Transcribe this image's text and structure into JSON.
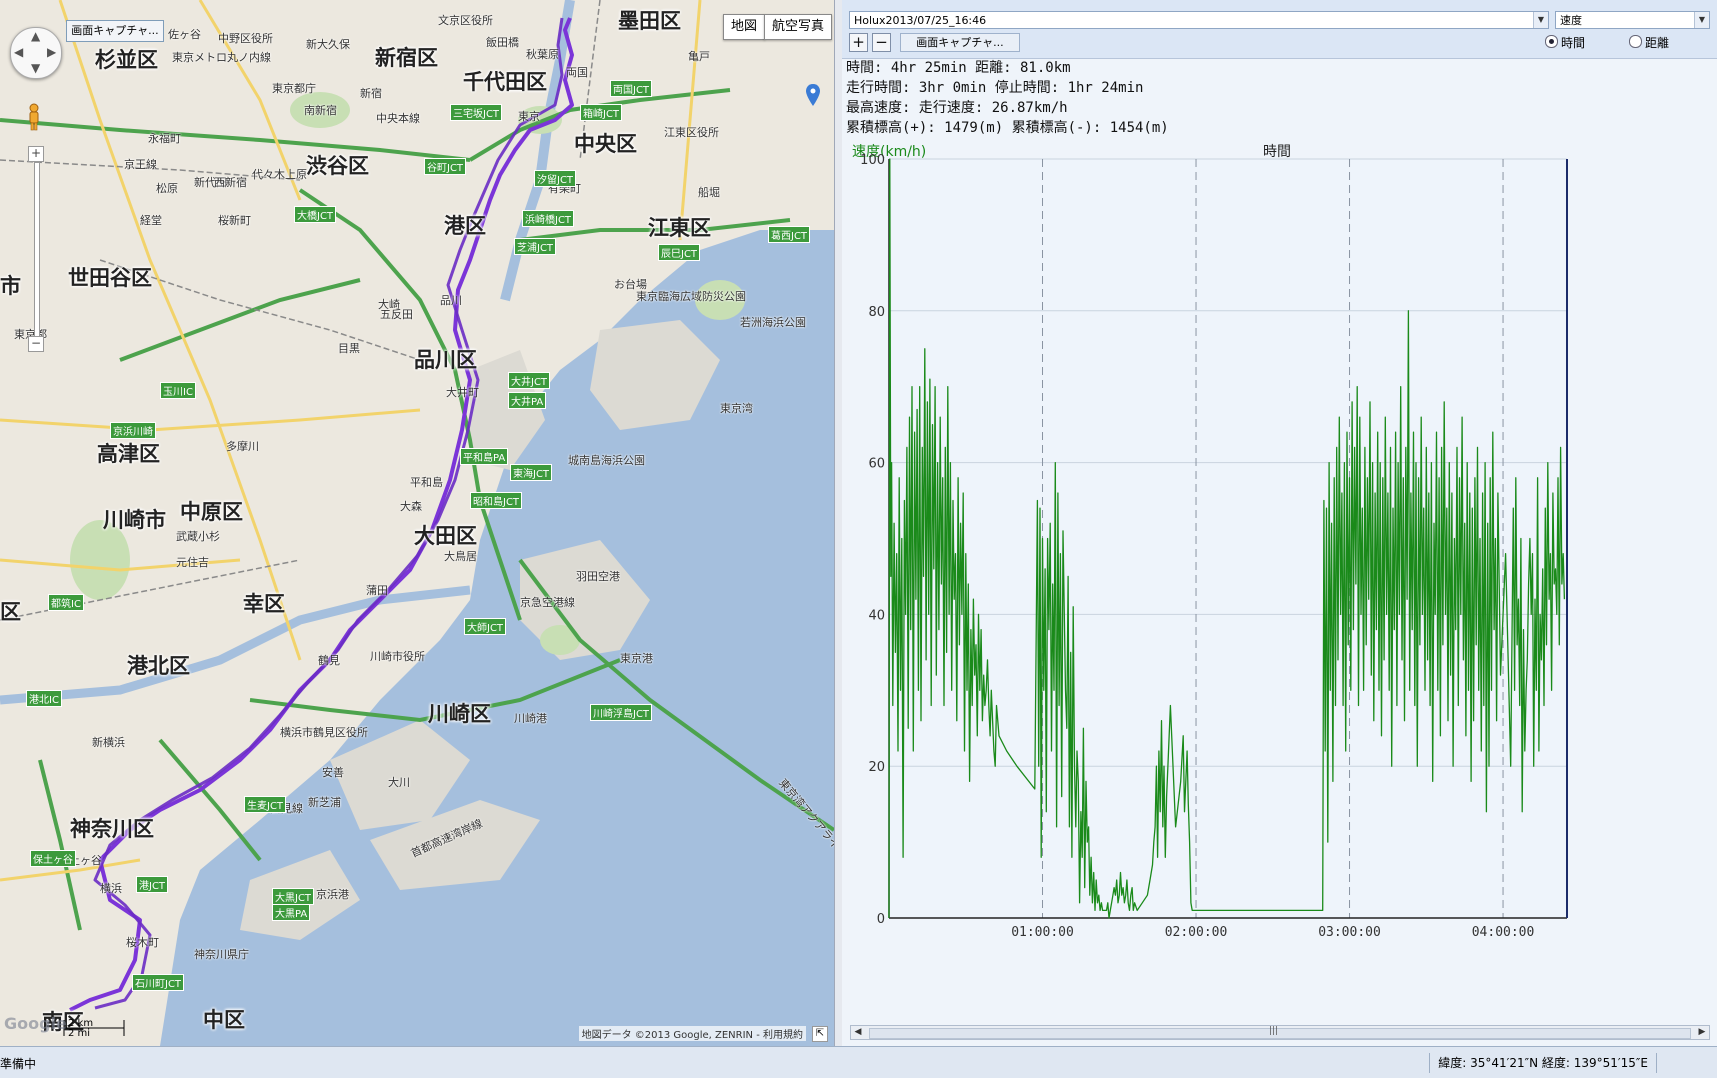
{
  "map": {
    "type_buttons": [
      "地図",
      "航空写真"
    ],
    "capture_button": "画面キャプチャ...",
    "wards": [
      "杉並区",
      "新宿区",
      "千代田区",
      "墨田区",
      "中央区",
      "渋谷区",
      "港区",
      "江東区",
      "世田谷区",
      "品川区",
      "高津区",
      "中原区",
      "川崎市",
      "大田区",
      "幸区",
      "港北区",
      "川崎区",
      "神奈川区",
      "中区",
      "南区",
      "市",
      "区"
    ],
    "small_labels": [
      "佐ヶ谷",
      "中野区役所",
      "文京区役所",
      "東京メトロ丸ノ内線",
      "新大久保",
      "飯田橋",
      "東京都庁",
      "新宿",
      "秋葉原",
      "両国",
      "亀戸",
      "南新宿",
      "中央本線",
      "東京",
      "江東区役所",
      "永福町",
      "京王線",
      "新代田",
      "代々木上原",
      "松原",
      "西新宿",
      "船堀",
      "経堂",
      "有楽町",
      "東京湾",
      "桜新町",
      "お台場",
      "大井町",
      "品川",
      "大崎",
      "五反田",
      "目黒",
      "武蔵小杉",
      "元住吉",
      "多摩川",
      "鶴見",
      "新横浜",
      "横浜",
      "桜木町",
      "京浜港",
      "川崎港",
      "羽田空港",
      "東京港",
      "平和島",
      "大森",
      "蒲田",
      "大鳥居",
      "京急空港線",
      "川崎市役所",
      "横浜市鶴見区役所",
      "首都高速湾岸線",
      "新芝浦",
      "安善",
      "大川",
      "鶴見線",
      "保土ヶ谷",
      "神奈川県庁",
      "東京都",
      "東京臨海広域防災公園",
      "若洲海浜公園",
      "城南島海浜公園",
      "東京湾アクアライン"
    ],
    "jct_labels": [
      "三宅坂JCT",
      "谷町JCT",
      "汐留JCT",
      "浜崎橋JCT",
      "芝浦JCT",
      "大橋JCT",
      "大井JCT",
      "大井PA",
      "平和島PA",
      "東海JCT",
      "昭和島JCT",
      "大師JCT",
      "生麦JCT",
      "大黒JCT",
      "大黒PA",
      "川崎浮島JCT",
      "辰巳JCT",
      "葛西JCT",
      "箱崎JCT",
      "両国JCT",
      "京浜川崎",
      "玉川IC",
      "都筑IC",
      "港北IC",
      "保土ヶ谷",
      "石川町JCT",
      "港JCT"
    ],
    "scale_km": "2 km",
    "scale_mi": "2 mi",
    "attribution": "地図データ ©2013 Google, ZENRIN - 利用規約",
    "google_logo": "Google",
    "route_color": "#7b35d8"
  },
  "toolbar": {
    "file": "Holux2013/07/25_16:46",
    "metric": "速度",
    "add": "+",
    "remove": "−",
    "capture_button": "画面キャプチャ...",
    "radio_time": "時間",
    "radio_distance": "距離",
    "selected_radio": "時間"
  },
  "stats": {
    "line1": "時間: 4hr 25min 距離: 81.0km",
    "line2": "走行時間: 3hr 0min 停止時間: 1hr 24min",
    "line3": "最高速度:          走行速度: 26.87km/h",
    "line4": "累積標高(+): 1479(m) 累積標高(-): 1454(m)"
  },
  "chart_data": {
    "type": "line",
    "title": "時間",
    "ylabel": "速度(km/h)",
    "xlabel": "",
    "ylim": [
      0,
      100
    ],
    "xlim_minutes": [
      0,
      265
    ],
    "y_ticks": [
      0,
      20,
      40,
      60,
      80,
      100
    ],
    "x_ticks": [
      "01:00:00",
      "02:00:00",
      "03:00:00",
      "04:00:00"
    ],
    "x_tick_minutes": [
      60,
      120,
      180,
      240
    ],
    "grid": true,
    "line_color": "#1a8a1a",
    "series": [
      {
        "x_minutes": [
          0,
          0.3,
          0.7,
          1,
          1.5,
          2,
          2.5,
          3,
          3.5,
          4,
          4.5,
          5,
          5.5,
          6,
          6.5,
          7,
          7.5,
          8,
          8.5,
          9,
          9.5,
          10,
          10.5,
          11,
          11.5,
          12,
          12.5,
          13,
          13.5,
          14,
          14.5,
          15,
          15.5,
          16,
          16.5,
          17,
          17.5,
          18,
          18.5,
          19,
          19.5,
          20,
          20.5,
          21,
          21.5,
          22,
          22.5,
          23,
          23.5,
          24,
          24.5,
          25,
          25.5,
          26,
          26.5,
          27,
          27.5,
          28,
          28.5,
          29,
          29.5,
          30,
          30.5,
          31,
          31.5,
          32,
          32.5,
          33,
          33.5,
          34,
          34.5,
          35,
          35.5,
          36,
          36.5,
          37,
          37.5,
          38,
          38.5,
          39,
          39.5,
          40,
          40.5,
          41,
          41.5,
          42,
          43,
          46,
          50,
          57,
          58,
          58.5,
          59,
          59.5,
          60,
          60.5,
          61,
          61.5,
          62,
          62.5,
          63,
          63.5,
          64,
          64.5,
          65,
          65.5,
          66,
          66.5,
          67,
          67.5,
          68,
          68.5,
          69,
          69.5,
          70,
          70.5,
          71,
          71.5,
          72,
          72.5,
          73,
          73.5,
          74,
          74.5,
          75,
          75.5,
          76,
          76.5,
          77,
          77.5,
          78,
          78.5,
          79,
          79.5,
          80,
          80.5,
          81,
          81.5,
          82,
          82.5,
          83,
          83.5,
          84,
          84.5,
          85,
          85.5,
          86,
          86.5,
          87,
          87.5,
          88,
          88.5,
          89,
          89.5,
          90,
          90.5,
          91,
          91.5,
          92,
          92.5,
          93,
          93.5,
          94,
          94.5,
          95,
          95.5,
          96,
          97,
          99,
          101,
          102,
          103,
          103.5,
          104,
          104.5,
          105,
          105.5,
          106,
          106.5,
          107,
          107.5,
          108,
          108.5,
          109,
          110,
          112,
          114,
          115,
          115.5,
          116,
          116.5,
          117,
          117.5,
          118,
          118.5,
          119,
          119.5,
          120,
          120.5,
          121,
          121.5,
          122,
          122.5,
          123,
          123.5,
          124,
          130,
          140,
          150,
          155,
          160,
          164,
          164.5,
          165,
          165.5,
          166,
          166.5,
          167,
          167.5,
          168,
          168.5,
          169,
          169.5,
          170,
          170.5,
          171,
          171.5,
          172,
          172.5,
          173,
          173.5,
          174,
          174.5,
          175,
          175.5,
          176,
          176.5,
          177,
          177.5,
          178,
          178.5,
          179,
          179.5,
          180,
          180.5,
          181,
          181.5,
          182,
          182.5,
          183,
          183.5,
          184,
          184.5,
          185,
          185.5,
          186,
          186.5,
          187,
          187.5,
          188,
          188.5,
          189,
          189.5,
          190,
          190.5,
          191,
          191.5,
          192,
          192.5,
          193,
          193.5,
          194,
          194.5,
          195,
          195.5,
          196,
          196.5,
          197,
          197.5,
          198,
          198.5,
          199,
          199.5,
          200,
          200.5,
          201,
          201.5,
          202,
          202.5,
          203,
          203.5,
          204,
          204.5,
          205,
          205.5,
          206,
          206.5,
          207,
          207.5,
          208,
          208.5,
          209,
          209.5,
          210,
          210.5,
          211,
          211.5,
          212,
          212.5,
          213,
          213.5,
          214,
          214.5,
          215,
          215.5,
          216,
          216.5,
          217,
          217.5,
          218,
          218.5,
          219,
          219.5,
          220,
          220.5,
          221,
          221.5,
          222,
          222.5,
          223,
          223.5,
          224,
          224.5,
          225,
          225.5,
          226,
          226.5,
          227,
          227.5,
          228,
          228.5,
          229,
          229.5,
          230,
          230.5,
          231,
          231.5,
          232,
          232.5,
          233,
          233.5,
          234,
          234.5,
          235,
          235.5,
          236,
          236.5,
          237,
          237.5,
          238,
          239,
          241,
          243,
          244,
          244.5,
          245,
          245.5,
          246,
          246.5,
          247,
          247.5,
          248,
          248.5,
          249,
          249.5,
          250,
          250.5,
          251,
          251.5,
          252,
          252.5,
          253,
          253.5,
          254,
          254.5,
          255,
          255.5,
          256,
          256.5,
          257,
          257.5,
          258,
          258.5,
          259,
          259.5,
          260,
          260.5,
          261,
          261.5,
          262,
          262.5,
          263,
          263.5,
          264,
          264.5
        ],
        "values": [
          0,
          100,
          45,
          60,
          28,
          52,
          35,
          48,
          22,
          58,
          30,
          50,
          8,
          55,
          40,
          62,
          25,
          66,
          38,
          70,
          22,
          64,
          42,
          67,
          30,
          70,
          26,
          62,
          45,
          75,
          34,
          68,
          40,
          71,
          28,
          65,
          46,
          70,
          32,
          60,
          38,
          66,
          44,
          58,
          28,
          62,
          35,
          70,
          40,
          60,
          30,
          55,
          42,
          48,
          26,
          58,
          36,
          52,
          40,
          56,
          22,
          48,
          30,
          44,
          18,
          38,
          28,
          42,
          32,
          36,
          24,
          40,
          30,
          38,
          26,
          32,
          28,
          30,
          34,
          28,
          24,
          30,
          26,
          22,
          20,
          28,
          24,
          22,
          20,
          17,
          55,
          20,
          54,
          8,
          50,
          30,
          46,
          14,
          50,
          38,
          52,
          22,
          44,
          30,
          60,
          12,
          56,
          28,
          48,
          16,
          51,
          40,
          30,
          25,
          45,
          12,
          35,
          8,
          41,
          20,
          12,
          22,
          18,
          2,
          14,
          8,
          25,
          4,
          18,
          10,
          12,
          3,
          8,
          2,
          6,
          1,
          5,
          2,
          3,
          1,
          2,
          1,
          1,
          1,
          1,
          2,
          0,
          1,
          2,
          3,
          4,
          3,
          5,
          2,
          3,
          6,
          3,
          4,
          2,
          3,
          5,
          2,
          1,
          3,
          4,
          1,
          2,
          1,
          2,
          3,
          5,
          7,
          10,
          12,
          20,
          8,
          22,
          14,
          26,
          12,
          20,
          8,
          16,
          20,
          28,
          12,
          18,
          24,
          14,
          18,
          22,
          15,
          10,
          2,
          1,
          1,
          1,
          1,
          1,
          1,
          1,
          1,
          1,
          1,
          1,
          1,
          1,
          1,
          1,
          1,
          1,
          1,
          1,
          1,
          1,
          1,
          1,
          1,
          1,
          1,
          1,
          1,
          1,
          55,
          22,
          54,
          10,
          60,
          30,
          52,
          18,
          58,
          28,
          62,
          34,
          66,
          40,
          56,
          28,
          60,
          22,
          64,
          36,
          58,
          30,
          68,
          38,
          62,
          44,
          70,
          28,
          66,
          40,
          54,
          30,
          62,
          36,
          58,
          42,
          68,
          32,
          60,
          26,
          56,
          38,
          64,
          30,
          60,
          24,
          58,
          34,
          66,
          40,
          56,
          30,
          62,
          20,
          54,
          38,
          64,
          28,
          60,
          40,
          70,
          34,
          58,
          26,
          62,
          42,
          80,
          30,
          56,
          38,
          64,
          28,
          60,
          20,
          58,
          36,
          66,
          40,
          54,
          30,
          62,
          34,
          56,
          28,
          60,
          18,
          52,
          40,
          64,
          30,
          58,
          24,
          62,
          36,
          68,
          40,
          54,
          26,
          60,
          32,
          56,
          20,
          50,
          38,
          62,
          28,
          58,
          40,
          66,
          34,
          52,
          24,
          60,
          30,
          56,
          18,
          54,
          26,
          58,
          36,
          62,
          30,
          50,
          22,
          56,
          28,
          60,
          14,
          52,
          20,
          58,
          30,
          64,
          38,
          50,
          26,
          56,
          32,
          48,
          20,
          54,
          30,
          58,
          36,
          42,
          28,
          50,
          14,
          38,
          22,
          30,
          34,
          44,
          50,
          40,
          48,
          20,
          42,
          30,
          58,
          22,
          40,
          34,
          46,
          28,
          54,
          36,
          60,
          42,
          48,
          30,
          56,
          44,
          46,
          40,
          58,
          36,
          62,
          44,
          48,
          42
        ]
      }
    ]
  },
  "status": {
    "left": "準備中",
    "coords": "緯度: 35°41′21″N 経度: 139°51′15″E"
  }
}
